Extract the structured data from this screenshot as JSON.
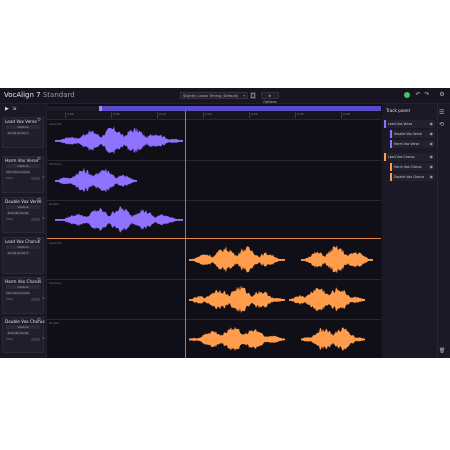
{
  "app": {
    "title": "VocAlign 7",
    "edition": "Standard",
    "preset": "Slightly Loose Timing (Default)",
    "options_label": "⊕ Options",
    "colors": {
      "guide": "#8f72ff",
      "dub": "#ff9d4d",
      "accent": "#3fc46a"
    }
  },
  "toolbar": {
    "play_icon": "▶",
    "select_icon": "⇲",
    "dropdown_icon": "▾",
    "save_icon": "save-icon",
    "status_icon": "●",
    "undo_icon": "↶",
    "redo_icon": "↷",
    "settings_icon": "⚙"
  },
  "ruler": {
    "ticks": [
      "0:00",
      "0:05",
      "0:10",
      "0:15",
      "0:20",
      "0:25",
      "0:30"
    ]
  },
  "tracks": [
    {
      "name": "Lead Vox Verse",
      "mode": "Capture",
      "slot": "Guide Guide 1",
      "role": "guide",
      "menu": "⚙",
      "lane_tag": "Lead Vox"
    },
    {
      "name": "Harm Vox Verse",
      "mode": "Capture",
      "slot": "Dub Harm Guide",
      "role": "guide",
      "extra": "Time",
      "menu": "⚙",
      "lane_tag": "Harmony"
    },
    {
      "name": "Double Vox Verse",
      "mode": "Capture",
      "slot": "Dub Dbl Guide",
      "role": "guide",
      "extra": "Time",
      "menu": "⚙",
      "lane_tag": "Double"
    },
    {
      "name": "Lead Vox Chorus",
      "mode": "Capture",
      "slot": "Guide Guide 3",
      "role": "dub",
      "menu": "⚙",
      "lane_tag": "Lead Vox"
    },
    {
      "name": "Harm Vox Chorus",
      "mode": "Capture",
      "slot": "Dub Harm Guide",
      "role": "dub",
      "extra": "Time",
      "menu": "⚙",
      "lane_tag": "Harmony"
    },
    {
      "name": "Double Vox Chorus",
      "mode": "Capture",
      "slot": "Dub Dbl Guide",
      "role": "dub",
      "extra": "Time",
      "menu": "⚙",
      "lane_tag": "Double"
    }
  ],
  "track_panel": {
    "title": "Track panel",
    "items": [
      {
        "label": "Lead Vox Verse",
        "color": "#8f72ff",
        "eye": "👁"
      },
      {
        "label": "Double Vox Verse",
        "color": "#8f72ff",
        "eye": "👁"
      },
      {
        "label": "Harm Vox Verse",
        "color": "#8f72ff",
        "eye": "👁"
      },
      {
        "label": "Lead Vox Chorus",
        "color": "#ff9d4d",
        "eye": "👁"
      },
      {
        "label": "Harm Vox Chorus",
        "color": "#ff9d4d",
        "eye": "👁"
      },
      {
        "label": "Double Vox Chorus",
        "color": "#ff9d4d",
        "eye": "👁"
      }
    ],
    "list_icon": "☰",
    "history_icon": "⟲",
    "trash_icon": "🗑"
  }
}
